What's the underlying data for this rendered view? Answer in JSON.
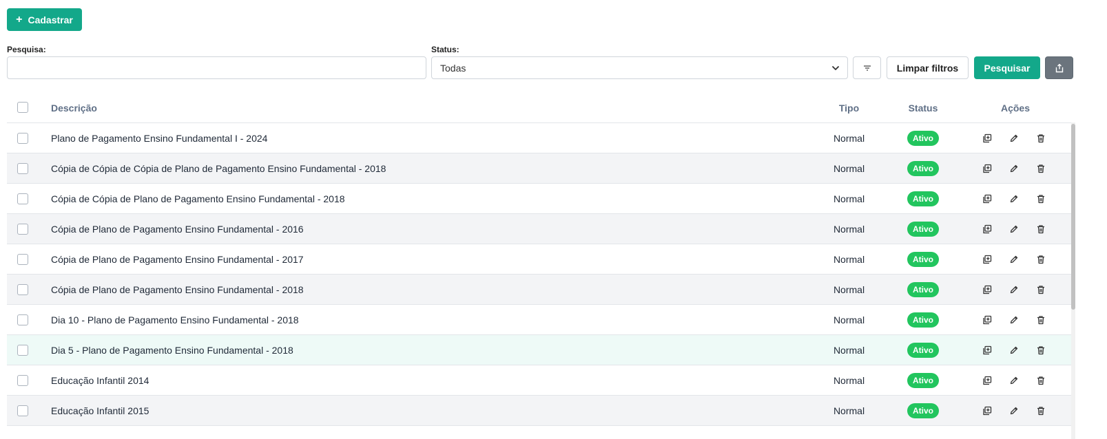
{
  "toolbar": {
    "cadastrar_label": "Cadastrar",
    "search_label": "Pesquisa:",
    "search_value": "",
    "status_label": "Status:",
    "status_value": "Todas",
    "limpar_label": "Limpar filtros",
    "pesquisar_label": "Pesquisar"
  },
  "table": {
    "headers": {
      "descricao": "Descrição",
      "tipo": "Tipo",
      "status": "Status",
      "acoes": "Ações"
    },
    "rows": [
      {
        "descricao": "Plano de Pagamento Ensino Fundamental I - 2024",
        "tipo": "Normal",
        "status": "Ativo"
      },
      {
        "descricao": "Cópia de Cópia de Cópia de Plano de Pagamento Ensino Fundamental - 2018",
        "tipo": "Normal",
        "status": "Ativo"
      },
      {
        "descricao": "Cópia de Cópia de Plano de Pagamento Ensino Fundamental - 2018",
        "tipo": "Normal",
        "status": "Ativo"
      },
      {
        "descricao": "Cópia de Plano de Pagamento Ensino Fundamental - 2016",
        "tipo": "Normal",
        "status": "Ativo"
      },
      {
        "descricao": "Cópia de Plano de Pagamento Ensino Fundamental - 2017",
        "tipo": "Normal",
        "status": "Ativo"
      },
      {
        "descricao": "Cópia de Plano de Pagamento Ensino Fundamental - 2018",
        "tipo": "Normal",
        "status": "Ativo"
      },
      {
        "descricao": "Dia 10 - Plano de Pagamento Ensino Fundamental - 2018",
        "tipo": "Normal",
        "status": "Ativo"
      },
      {
        "descricao": "Dia 5 - Plano de Pagamento Ensino Fundamental - 2018",
        "tipo": "Normal",
        "status": "Ativo"
      },
      {
        "descricao": "Educação Infantil 2014",
        "tipo": "Normal",
        "status": "Ativo"
      },
      {
        "descricao": "Educação Infantil 2015",
        "tipo": "Normal",
        "status": "Ativo"
      }
    ]
  },
  "colors": {
    "primary": "#13a88a",
    "badge_active": "#22c55e",
    "header_text": "#5f6f86",
    "export_button": "#6b747d"
  },
  "icons": {
    "cadastrar": "plus-icon",
    "status_dropdown": "chevron-down-icon",
    "filter": "filter-icon",
    "export": "share-export-icon",
    "row_copy": "copy-icon",
    "row_edit": "pencil-icon",
    "row_delete": "trash-icon"
  }
}
